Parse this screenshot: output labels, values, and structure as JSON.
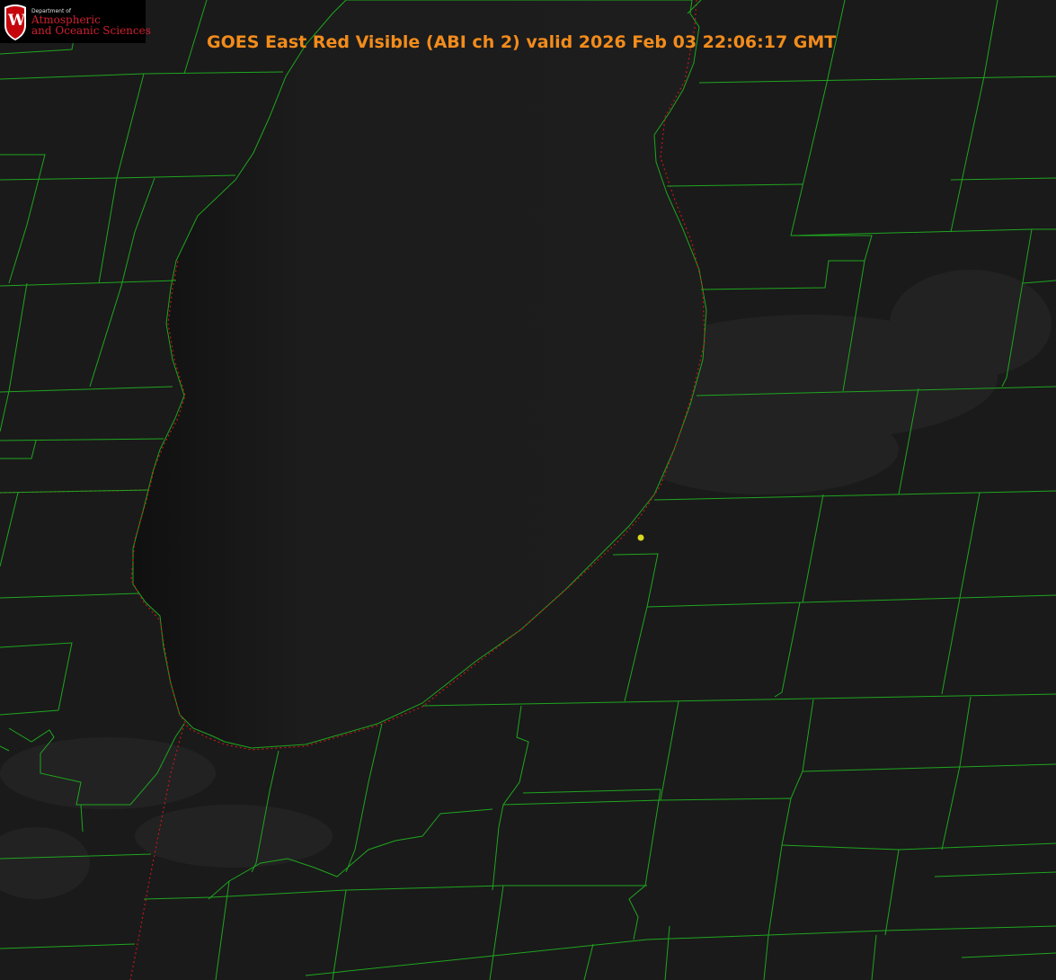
{
  "title": "GOES East Red Visible (ABI ch 2) valid 2026 Feb 03 22:06:17 GMT",
  "logo": {
    "department": "Department of",
    "line1": "Atmospheric",
    "line2": "and Oceanic Sciences",
    "letter": "W"
  },
  "colors": {
    "title": "#f28c1c",
    "boundary": "#1fa51f",
    "state_line": "#c01818",
    "marker": "#d8d820",
    "logo_red": "#d02030",
    "land": "#1a1a1a",
    "lake": "#1c1c1c"
  }
}
